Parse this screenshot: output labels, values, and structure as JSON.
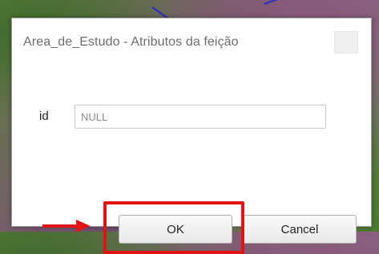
{
  "dialog": {
    "title": "Area_de_Estudo - Atributos da feição",
    "close_icon": "close-icon"
  },
  "form": {
    "fields": [
      {
        "label": "id",
        "value": "NULL"
      }
    ]
  },
  "buttons": {
    "ok_label": "OK",
    "cancel_label": "Cancel"
  },
  "annotation": {
    "color": "#e01414",
    "arrow_icon": "arrow-right-icon"
  }
}
